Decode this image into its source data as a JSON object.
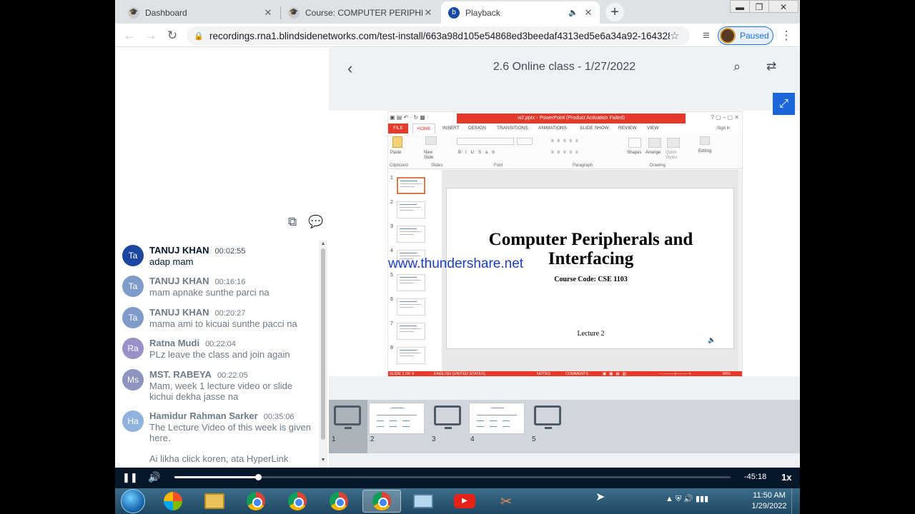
{
  "browser": {
    "tabs": [
      {
        "label": "Dashboard",
        "close": "✕",
        "icon": "moodle-icon"
      },
      {
        "label": "Course: COMPUTER PERIPHERALS",
        "close": "✕",
        "icon": "moodle-icon"
      },
      {
        "label": "Playback",
        "close": "✕",
        "icon": "bigbluebutton-icon",
        "audio": "🔈"
      }
    ],
    "new_tab": "+",
    "window_controls": {
      "minimize": "▬",
      "restore": "❐",
      "close": "✕"
    },
    "url": "recordings.rna1.blindsidenetworks.com/test-install/663a98d105e54868ed3beedaf4313ed5e6a34a92-164328...",
    "profile_status": "Paused",
    "nav": {
      "back": "←",
      "forward": "→",
      "reload": "↻",
      "star": "☆",
      "menu": "⋮",
      "queue": "≡"
    }
  },
  "chat": {
    "header_icons": [
      "copy-icon",
      "chat-bubbles-icon"
    ],
    "messages": [
      {
        "initials": "Ta",
        "name": "TANUJ KHAN",
        "time": "00:02:55",
        "text": "adap mam",
        "color": "#1b46a0",
        "dim": false
      },
      {
        "initials": "Ta",
        "name": "TANUJ KHAN",
        "time": "00:16:16",
        "text": "mam apnake sunthe parci na",
        "color": "#7f9bc9",
        "dim": true
      },
      {
        "initials": "Ta",
        "name": "TANUJ KHAN",
        "time": "00:20:27",
        "text": "mama ami to kicuai sunthe pacci na",
        "color": "#7f9bc9",
        "dim": true
      },
      {
        "initials": "Ra",
        "name": "Ratna Mudi",
        "time": "00:22:04",
        "text": "PLz leave the class and join again",
        "color": "#9a8fc7",
        "dim": true
      },
      {
        "initials": "Ms",
        "name": "MST. RABEYA",
        "time": "00:22:05",
        "text": "Mam, week 1 lecture video or slide kichui dekha jasse na",
        "color": "#8d94c2",
        "dim": true
      },
      {
        "initials": "Ha",
        "name": "Hamidur Rahman Sarker",
        "time": "00:35:06",
        "text": "The Lecture Video of this week is given here.",
        "color": "#8fb3dc",
        "dim": true
      },
      {
        "initials": "",
        "name": "",
        "time": "",
        "text": "Ai likha click koren, ata HyperLink",
        "color": "#ffffff",
        "dim": true
      }
    ]
  },
  "player": {
    "title": "2.6 Online class - 1/27/2022",
    "back_icon": "‹",
    "search_icon": "⌕",
    "swap_icon": "⇄",
    "fullscreen_icon": "⤢",
    "progress_fraction": 0.151,
    "remaining": "-45:18",
    "speed": "1x",
    "play_icon": "❚❚",
    "volume_icon": "🔊"
  },
  "slide": {
    "title_bar": "w2.pptx - PowerPoint (Product Activation Failed)",
    "menu": [
      "FILE",
      "HOME",
      "INSERT",
      "DESIGN",
      "TRANSITIONS",
      "ANIMATIONS",
      "SLIDE SHOW",
      "REVIEW",
      "VIEW"
    ],
    "sign_in": "Sign in",
    "ribbon_groups": [
      "Clipboard",
      "Slides",
      "Font",
      "Paragraph",
      "Drawing"
    ],
    "ribbon_labels": [
      "Paste",
      "New Slide",
      "Shapes",
      "Arrange",
      "Quick Styles",
      "Editing"
    ],
    "thumb_numbers": [
      "1",
      "2",
      "3",
      "4",
      "5",
      "6",
      "7",
      "8"
    ],
    "heading": "Computer Peripherals and Interfacing",
    "course_code": "Course Code: CSE 1103",
    "lecture": "Lecture 2",
    "watermark": "www.thundershare.net",
    "status_left": "SLIDE 1 OF 9",
    "status_lang": "ENGLISH (UNITED STATES)",
    "status_notes": "NOTES",
    "status_comments": "COMMENTS",
    "zoom": "55%"
  },
  "thumbnails": [
    {
      "num": "1",
      "kind": "screen",
      "selected": true
    },
    {
      "num": "2",
      "kind": "slide",
      "selected": false
    },
    {
      "num": "3",
      "kind": "screen",
      "selected": false
    },
    {
      "num": "4",
      "kind": "slide",
      "selected": false
    },
    {
      "num": "5",
      "kind": "screen",
      "selected": false
    }
  ],
  "taskbar": {
    "apps": [
      "windows-media-icon",
      "file-explorer-icon",
      "chrome-icon",
      "chrome-icon",
      "chrome-profile-icon",
      "chrome-active-icon",
      "remote-desktop-icon",
      "youtube-icon",
      "snipping-tool-icon"
    ],
    "time": "11:50 AM",
    "date": "1/29/2022",
    "tray": "▲  ⛨  🔊  ▮▮▮"
  }
}
